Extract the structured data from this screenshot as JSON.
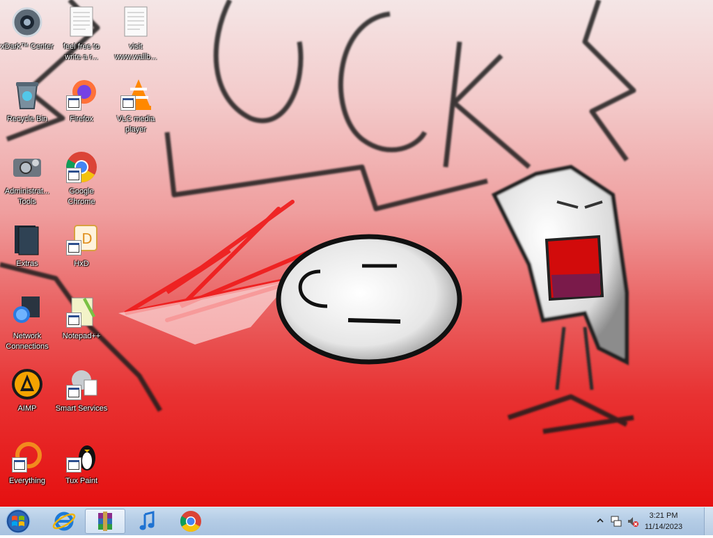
{
  "desktop": {
    "icons": [
      {
        "id": "xdark-center",
        "label": "xDark™ Center",
        "icon": "xdark-icon"
      },
      {
        "id": "feel-free",
        "label": "feel free to write a r...",
        "icon": "text-document-icon"
      },
      {
        "id": "visit",
        "label": "visit www.wallb...",
        "icon": "text-document-icon"
      },
      {
        "id": "recycle-bin",
        "label": "Recycle Bin",
        "icon": "recycle-bin-icon"
      },
      {
        "id": "firefox",
        "label": "Firefox",
        "icon": "firefox-icon"
      },
      {
        "id": "vlc",
        "label": "VLC media player",
        "icon": "vlc-icon"
      },
      {
        "id": "admin-tools",
        "label": "Administrat... Tools",
        "icon": "admin-tools-icon"
      },
      {
        "id": "chrome",
        "label": "Google Chrome",
        "icon": "chrome-icon"
      },
      {
        "id": "extras",
        "label": "Extras",
        "icon": "folder-icon"
      },
      {
        "id": "hxd",
        "label": "HxD",
        "icon": "hxd-icon"
      },
      {
        "id": "network",
        "label": "Network Connections",
        "icon": "network-icon"
      },
      {
        "id": "notepadpp",
        "label": "Notepad++",
        "icon": "notepadpp-icon"
      },
      {
        "id": "aimp",
        "label": "AIMP",
        "icon": "aimp-icon"
      },
      {
        "id": "smart-services",
        "label": "Smart Services",
        "icon": "smart-services-icon"
      },
      {
        "id": "everything",
        "label": "Everything",
        "icon": "everything-icon"
      },
      {
        "id": "tux-paint",
        "label": "Tux Paint",
        "icon": "tux-icon"
      }
    ]
  },
  "taskbar": {
    "start_icon": "windows-start-icon",
    "pinned": [
      {
        "id": "ie",
        "icon": "internet-explorer-icon"
      },
      {
        "id": "winrar",
        "icon": "winrar-icon",
        "active": true
      },
      {
        "id": "music",
        "icon": "music-note-icon"
      },
      {
        "id": "chrome",
        "icon": "chrome-icon"
      }
    ],
    "clock": {
      "time": "3:21 PM",
      "date": "11/14/2023"
    },
    "tray_icons": [
      "show-hidden-icons-chevron",
      "network-tray-icon",
      "volume-muted-icon"
    ]
  },
  "colors": {
    "chrome_red": "#db4437",
    "chrome_yellow": "#f4c20d",
    "chrome_green": "#0f9d58",
    "chrome_blue": "#4285f4",
    "wallpaper_red": "#e51010"
  }
}
